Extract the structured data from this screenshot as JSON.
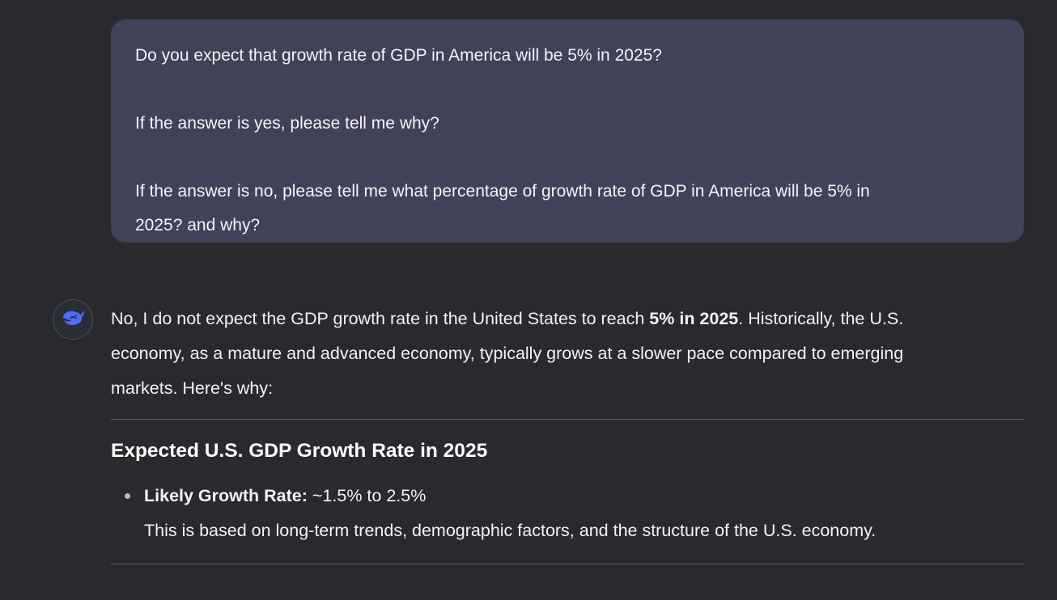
{
  "user_message": {
    "line1": "Do you expect that growth rate of GDP in America will be 5% in 2025?",
    "line2": "If the answer is yes, please tell me why?",
    "line3": "If the answer is no, please tell me what percentage of growth rate of GDP in America will be 5% in",
    "line4": "2025? and why?"
  },
  "assistant": {
    "avatar_icon": "whale-icon",
    "accent_color": "#4d6bfe",
    "intro_before": "No, I do not expect the GDP growth rate in the United States to reach ",
    "intro_bold": "5% in 2025",
    "intro_after_line1": ". Historically, the U.S.",
    "intro_line2": "economy, as a mature and advanced economy, typically grows at a slower pace compared to emerging",
    "intro_line3": "markets. Here's why:",
    "section_title": "Expected U.S. GDP Growth Rate in 2025",
    "bullets": [
      {
        "label": "Likely Growth Rate:",
        "value": " ~1.5% to 2.5%",
        "detail": "This is based on long-term trends, demographic factors, and the structure of the U.S. economy."
      }
    ]
  }
}
